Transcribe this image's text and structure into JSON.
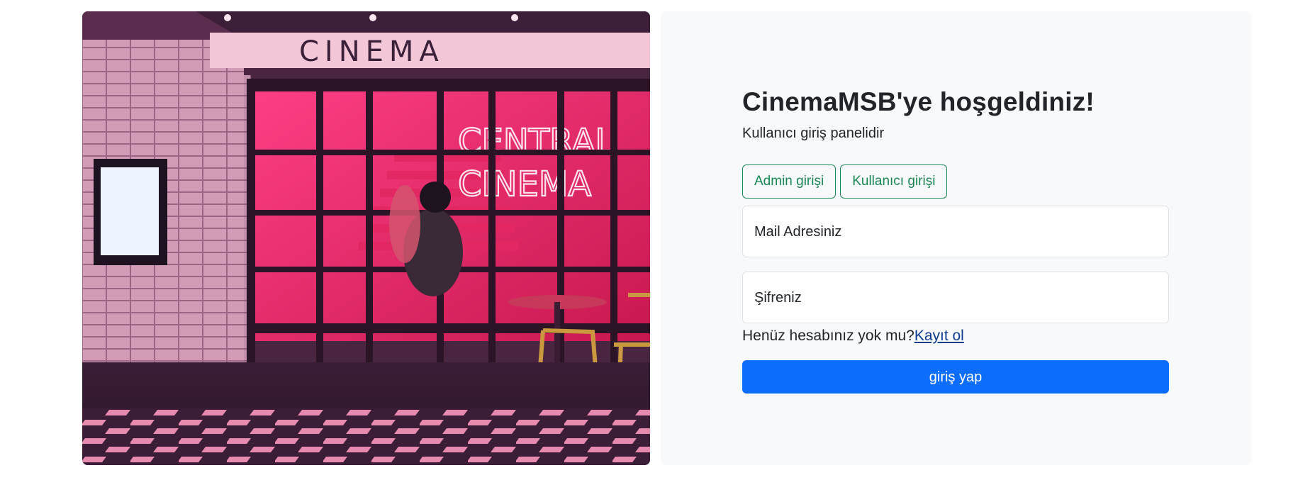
{
  "hero": {
    "sign_top": "CINEMA",
    "neon_line1": "CENTRAL",
    "neon_line2": "CINEMA"
  },
  "login": {
    "title": "CinemaMSB'ye hoşgeldiniz!",
    "subtitle": "Kullanıcı giriş panelidir",
    "tabs": [
      {
        "label": "Admin girişi"
      },
      {
        "label": "Kullanıcı girişi"
      }
    ],
    "email_label": "Mail Adresiniz",
    "password_label": "Şifreniz",
    "register_prompt": "Henüz hesabınız yok mu?",
    "register_link": "Kayıt ol",
    "submit_label": "giriş yap"
  },
  "colors": {
    "primary": "#0d6efd",
    "success_outline": "#198754",
    "panel_bg": "#f8f9fa"
  }
}
